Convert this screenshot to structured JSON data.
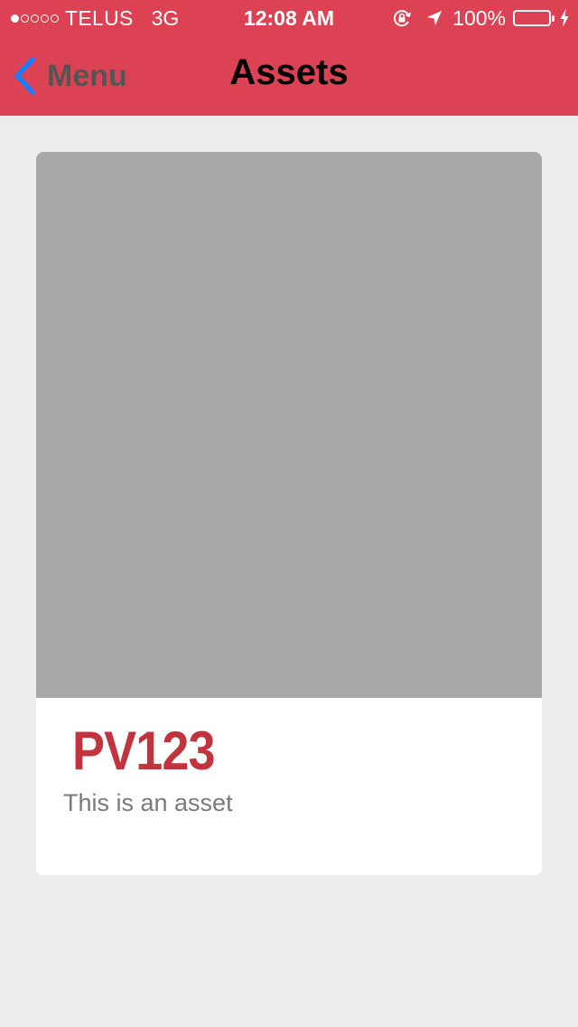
{
  "status_bar": {
    "carrier": "TELUS",
    "network": "3G",
    "time": "12:08 AM",
    "battery_percent": "100%",
    "signal_strength": 1,
    "signal_max": 5,
    "icons": [
      "rotation-lock-icon",
      "location-arrow-icon",
      "battery-icon",
      "charging-bolt-icon"
    ],
    "battery_color": "#4cd964"
  },
  "nav": {
    "back_label": "Menu",
    "title": "Assets",
    "back_icon": "chevron-left-icon",
    "back_icon_color": "#1a7cff"
  },
  "asset": {
    "code": "PV123",
    "description": "This is an asset"
  },
  "colors": {
    "header_bg": "#dc4253",
    "page_bg": "#ececec",
    "card_bg": "#ffffff",
    "image_placeholder": "#a9a9a9",
    "asset_code": "#c1343d",
    "asset_desc": "#7a7a7a"
  }
}
